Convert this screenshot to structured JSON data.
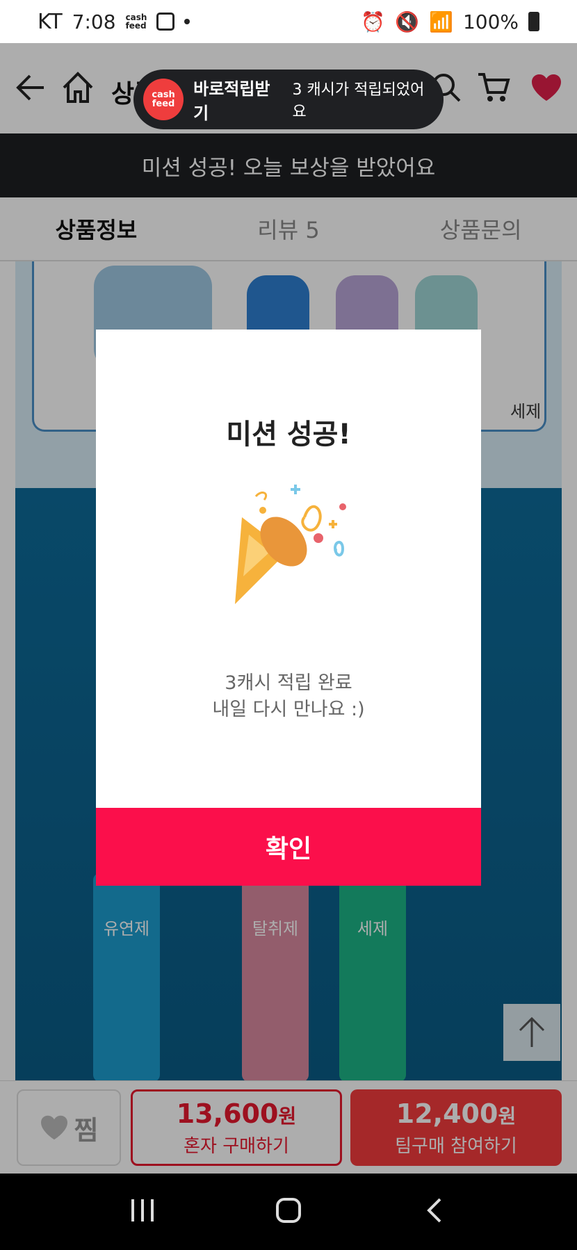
{
  "status_bar": {
    "carrier": "KT",
    "time": "7:08",
    "app_badge": "cash feed",
    "battery": "100%"
  },
  "header": {
    "title": "상품",
    "icons": [
      "back-arrow-icon",
      "home-icon",
      "search-icon",
      "cart-icon",
      "heart-icon"
    ]
  },
  "toast": {
    "logo_line1": "cash",
    "logo_line2": "feed",
    "strong": "바로적립받기",
    "message": "3 캐시가 적립되었어요"
  },
  "mission_banner": {
    "text": "미션 성공! 오늘 보상을 받았어요"
  },
  "tabs": [
    {
      "label": "상품정보",
      "active": true
    },
    {
      "label": "리뷰 5",
      "active": false
    },
    {
      "label": "상품문의",
      "active": false
    }
  ],
  "content": {
    "panel_label": "세제",
    "tube_labels": [
      "유연제",
      "탈취제",
      "세제"
    ]
  },
  "modal": {
    "title": "미션 성공!",
    "message_line1": "3캐시 적립 완료",
    "message_line2": "내일 다시 만나요 :)",
    "confirm_label": "확인"
  },
  "bottom_bar": {
    "wish_label": "찜",
    "solo_price": "13,600",
    "solo_unit": "원",
    "solo_label": "혼자 구매하기",
    "team_price": "12,400",
    "team_unit": "원",
    "team_label": "팀구매 참여하기"
  },
  "colors": {
    "accent": "#fb0f4b",
    "team_button": "#f33b3d",
    "banner": "#1e1f22"
  }
}
